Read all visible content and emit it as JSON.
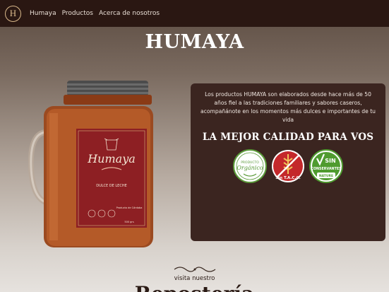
{
  "nav": {
    "logo_letter": "H",
    "links": [
      "Humaya",
      "Productos",
      "Acerca de nosotros"
    ]
  },
  "hero": {
    "title": "HUMAYA"
  },
  "jar": {
    "label_brand": "Humaya",
    "label_product": "DULCE DE LECHE",
    "label_origin": "Producto de Córdoba",
    "label_weight": "500 grs"
  },
  "info": {
    "text": "Los productos HUMAYA son elaborados desde hace más de 50 años fiel a las tradiciones familiares y sabores caseros, acompañánote en los momentos más dulces e importantes de tu vida",
    "heading": "LA MEJOR CALIDAD PARA VOS",
    "badges": [
      {
        "name": "organic-badge",
        "line1": "PRODUCTO",
        "line2": "Orgánico",
        "color": "#5b9a3a"
      },
      {
        "name": "sin-tacc-badge",
        "line1": "Sin T.A.C.C.",
        "color": "#c4282b"
      },
      {
        "name": "sin-conservantes-badge",
        "line1": "SIN",
        "line2": "CONSERVANTES",
        "line3": "NATURE",
        "color": "#4f9b2f"
      }
    ]
  },
  "footer": {
    "visit_text": "visita nuestro",
    "big_title": "Repostería"
  }
}
